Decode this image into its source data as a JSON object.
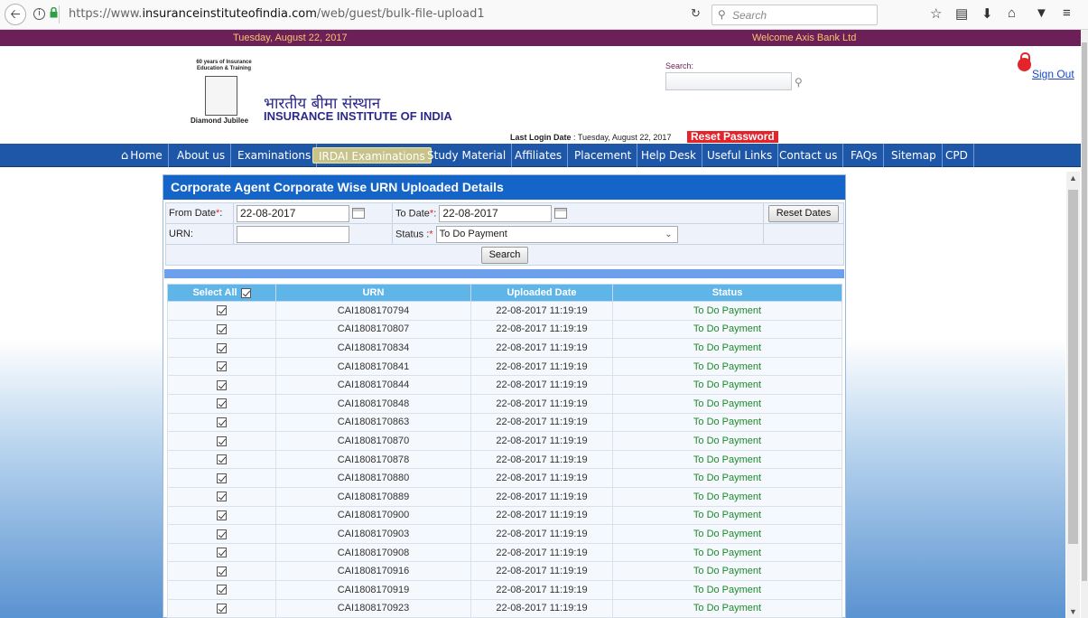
{
  "browser": {
    "url_prefix": "https://www.",
    "url_domain": "insuranceinstituteofindia.com",
    "url_path": "/web/guest/bulk-file-upload1",
    "search_placeholder": "Search"
  },
  "topbar": {
    "date": "Tuesday, August 22, 2017",
    "welcome": "Welcome Axis Bank Ltd"
  },
  "header": {
    "logo_years": "60 years of Insurance Education & Training",
    "logo_jubilee": "Diamond Jubilee",
    "hindi_name": "भारतीय बीमा संस्थान",
    "english_name": "INSURANCE INSTITUTE OF INDIA",
    "search_label": "Search:",
    "sign_out": "Sign Out",
    "last_login_label": "Last Login Date",
    "last_login_value": ": Tuesday, August 22, 2017",
    "reset_password": "Reset Password"
  },
  "nav": {
    "items": [
      "Home",
      "About us",
      "Examinations",
      "IRDAI Examinations",
      "Study Material",
      "Affiliates",
      "Placement",
      "Help Desk",
      "Useful Links",
      "Contact us",
      "FAQs",
      "Sitemap",
      "CPD"
    ],
    "active": "IRDAI Examinations"
  },
  "panel": {
    "title": "Corporate Agent Corporate Wise URN Uploaded Details",
    "from_date_label": "From Date",
    "from_date_value": "22-08-2017",
    "to_date_label": "To Date",
    "to_date_value": "22-08-2017",
    "reset_dates": "Reset Dates",
    "urn_label": "URN:",
    "urn_value": "",
    "status_label": "Status :",
    "status_value": "To Do Payment",
    "search_button": "Search"
  },
  "table": {
    "headers": [
      "Select All",
      "URN",
      "Uploaded Date",
      "Status"
    ],
    "rows": [
      {
        "urn": "CAI1808170794",
        "date": "22-08-2017 11:19:19",
        "status": "To Do Payment"
      },
      {
        "urn": "CAI1808170807",
        "date": "22-08-2017 11:19:19",
        "status": "To Do Payment"
      },
      {
        "urn": "CAI1808170834",
        "date": "22-08-2017 11:19:19",
        "status": "To Do Payment"
      },
      {
        "urn": "CAI1808170841",
        "date": "22-08-2017 11:19:19",
        "status": "To Do Payment"
      },
      {
        "urn": "CAI1808170844",
        "date": "22-08-2017 11:19:19",
        "status": "To Do Payment"
      },
      {
        "urn": "CAI1808170848",
        "date": "22-08-2017 11:19:19",
        "status": "To Do Payment"
      },
      {
        "urn": "CAI1808170863",
        "date": "22-08-2017 11:19:19",
        "status": "To Do Payment"
      },
      {
        "urn": "CAI1808170870",
        "date": "22-08-2017 11:19:19",
        "status": "To Do Payment"
      },
      {
        "urn": "CAI1808170878",
        "date": "22-08-2017 11:19:19",
        "status": "To Do Payment"
      },
      {
        "urn": "CAI1808170880",
        "date": "22-08-2017 11:19:19",
        "status": "To Do Payment"
      },
      {
        "urn": "CAI1808170889",
        "date": "22-08-2017 11:19:19",
        "status": "To Do Payment"
      },
      {
        "urn": "CAI1808170900",
        "date": "22-08-2017 11:19:19",
        "status": "To Do Payment"
      },
      {
        "urn": "CAI1808170903",
        "date": "22-08-2017 11:19:19",
        "status": "To Do Payment"
      },
      {
        "urn": "CAI1808170908",
        "date": "22-08-2017 11:19:19",
        "status": "To Do Payment"
      },
      {
        "urn": "CAI1808170916",
        "date": "22-08-2017 11:19:19",
        "status": "To Do Payment"
      },
      {
        "urn": "CAI1808170919",
        "date": "22-08-2017 11:19:19",
        "status": "To Do Payment"
      },
      {
        "urn": "CAI1808170923",
        "date": "22-08-2017 11:19:19",
        "status": "To Do Payment"
      }
    ]
  },
  "colors": {
    "topbar": "#6d1f58",
    "nav": "#1f57a8",
    "panel_title": "#1565c8",
    "table_header": "#5fb5e8",
    "status_text": "#1d8a2c",
    "reset_password_bg": "#e3242b"
  }
}
